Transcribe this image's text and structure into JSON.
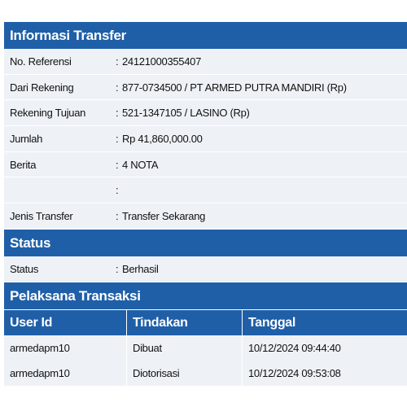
{
  "sections": {
    "transfer_title": "Informasi Transfer",
    "status_title": "Status",
    "executor_title": "Pelaksana Transaksi"
  },
  "transfer": {
    "rows": [
      {
        "label": "No. Referensi",
        "value": "24121000355407"
      },
      {
        "label": "Dari Rekening",
        "value": "877-0734500 / PT ARMED PUTRA MANDIRI  (Rp)"
      },
      {
        "label": "Rekening Tujuan",
        "value": "521-1347105 / LASINO  (Rp)"
      },
      {
        "label": "Jumlah",
        "value": "Rp  41,860,000.00"
      },
      {
        "label": "Berita",
        "value": "4 NOTA"
      },
      {
        "label": "",
        "value": ""
      },
      {
        "label": "Jenis Transfer",
        "value": "Transfer Sekarang"
      }
    ]
  },
  "status": {
    "label": "Status",
    "value": "Berhasil"
  },
  "executor": {
    "columns": [
      "User Id",
      "Tindakan",
      "Tanggal"
    ],
    "rows": [
      [
        "armedapm10",
        "Dibuat",
        "10/12/2024 09:44:40"
      ],
      [
        "armedapm10",
        "Diotorisasi",
        "10/12/2024 09:53:08"
      ]
    ]
  },
  "colors": {
    "header_bg": "#1f5fa8",
    "alt_row_bg": "#eef2f7"
  }
}
